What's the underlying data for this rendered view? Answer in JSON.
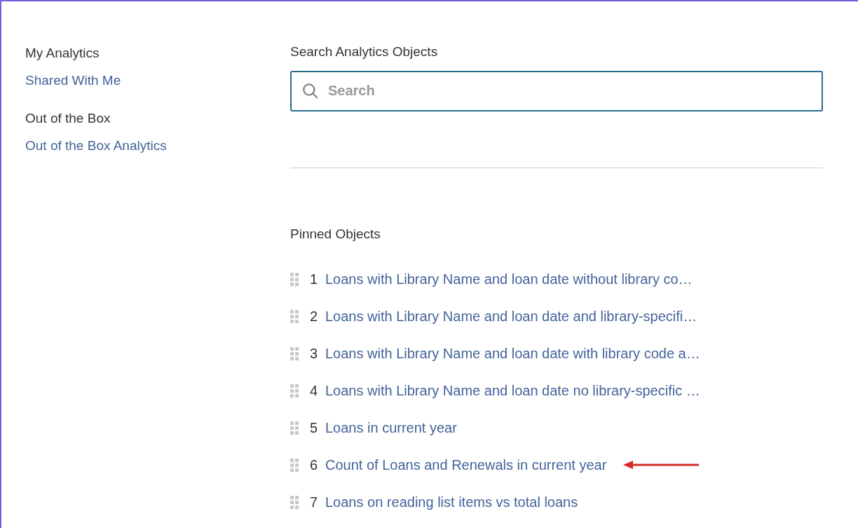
{
  "sidebar": {
    "sections": [
      {
        "heading": "My Analytics",
        "links": [
          "Shared With Me"
        ]
      },
      {
        "heading": "Out of the Box",
        "links": [
          "Out of the Box Analytics"
        ]
      }
    ]
  },
  "search": {
    "label": "Search Analytics Objects",
    "placeholder": "Search"
  },
  "pinned": {
    "title": "Pinned Objects",
    "items": [
      {
        "number": "1",
        "name": "Loans with Library Name and loan date without library co…",
        "arrow": false
      },
      {
        "number": "2",
        "name": "Loans with Library Name and loan date and library-specifi…",
        "arrow": false
      },
      {
        "number": "3",
        "name": "Loans with Library Name and loan date with library code a…",
        "arrow": false
      },
      {
        "number": "4",
        "name": "Loans with Library Name and loan date no library-specific …",
        "arrow": false
      },
      {
        "number": "5",
        "name": "Loans in current year",
        "arrow": false
      },
      {
        "number": "6",
        "name": "Count of Loans and Renewals in current year",
        "arrow": true
      },
      {
        "number": "7",
        "name": "Loans on reading list items vs total loans",
        "arrow": false
      }
    ]
  }
}
